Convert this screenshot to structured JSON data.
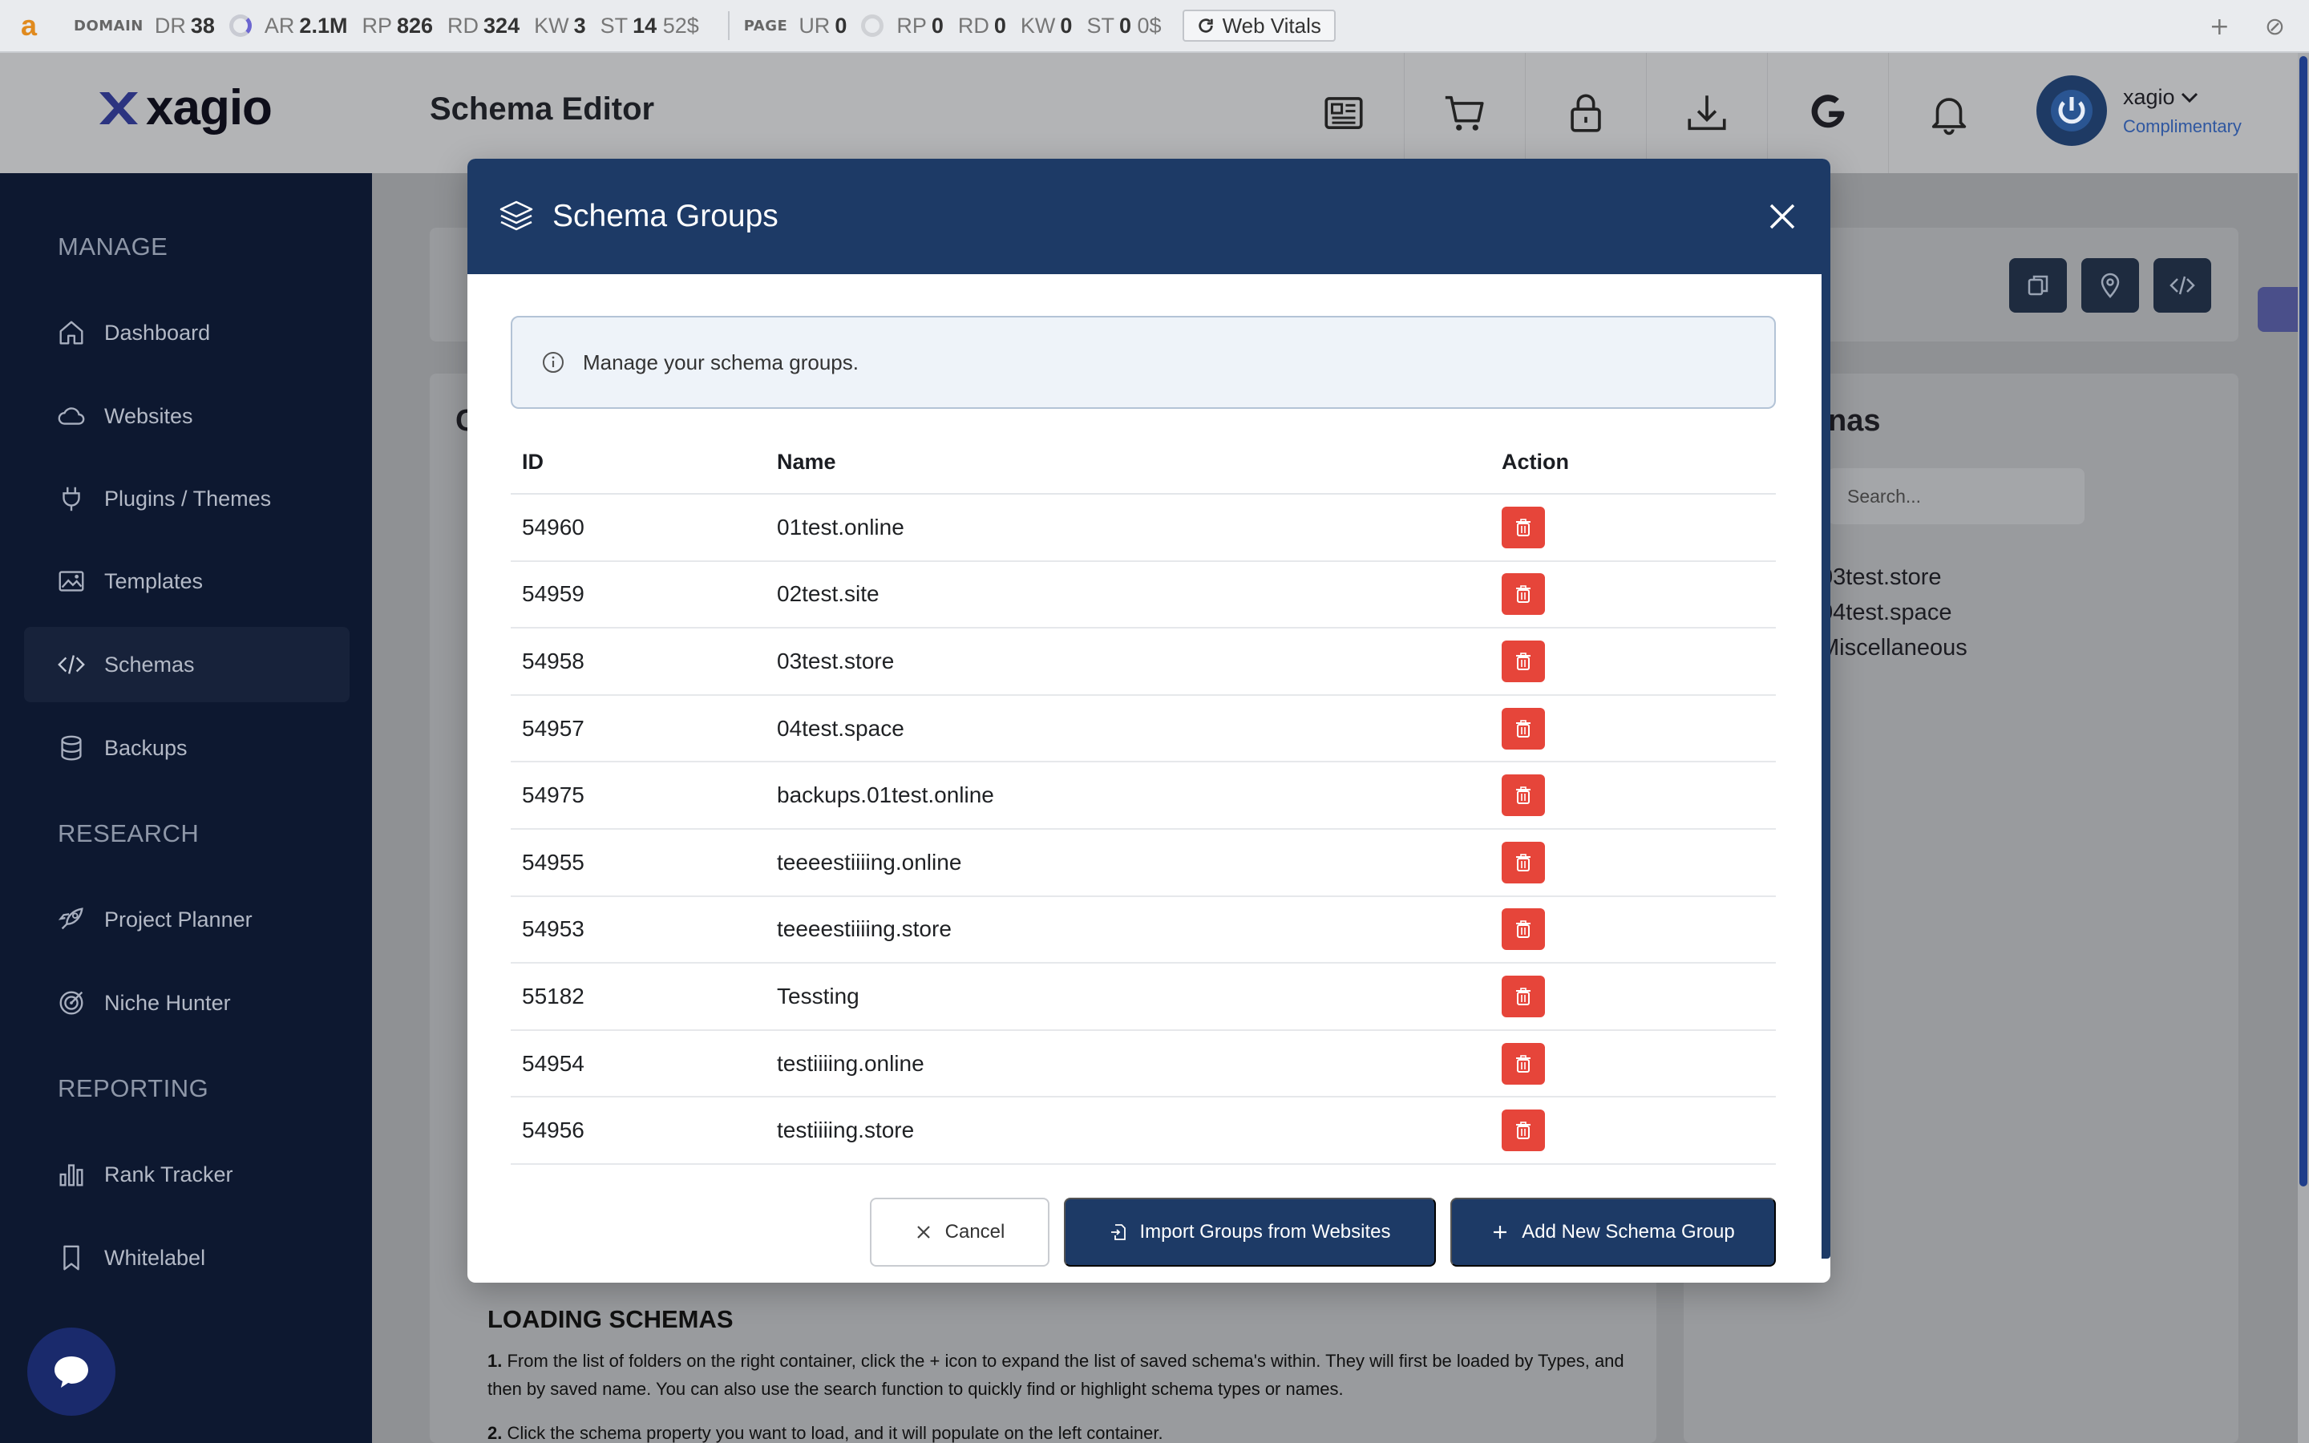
{
  "seo_bar": {
    "logo": "a",
    "domain_label": "DOMAIN",
    "domain": [
      {
        "k": "DR",
        "v": "38"
      },
      {
        "k": "AR",
        "v": "2.1M"
      },
      {
        "k": "RP",
        "v": "826"
      },
      {
        "k": "RD",
        "v": "324"
      },
      {
        "k": "KW",
        "v": "3"
      },
      {
        "k": "ST",
        "v": "14"
      }
    ],
    "domain_cost": "52$",
    "page_label": "PAGE",
    "page": [
      {
        "k": "UR",
        "v": "0"
      },
      {
        "k": "RP",
        "v": "0"
      },
      {
        "k": "RD",
        "v": "0"
      },
      {
        "k": "KW",
        "v": "0"
      },
      {
        "k": "ST",
        "v": "0"
      }
    ],
    "page_cost": "0$",
    "web_vitals": "Web Vitals",
    "plus": "+",
    "block": "⊘"
  },
  "header": {
    "logo_text": "xagio",
    "title": "Schema Editor",
    "icons": [
      "news-icon",
      "cart-icon",
      "lock-icon",
      "download-icon",
      "google-icon",
      "bell-icon"
    ],
    "user_name": "xagio",
    "user_plan": "Complimentary"
  },
  "sidebar": {
    "sections": [
      {
        "title": "MANAGE",
        "items": [
          "Dashboard",
          "Websites",
          "Plugins / Themes",
          "Templates",
          "Schemas",
          "Backups"
        ]
      },
      {
        "title": "RESEARCH",
        "items": [
          "Project Planner",
          "Niche Hunter"
        ]
      },
      {
        "title": "REPORTING",
        "items": [
          "Rank Tracker",
          "Whitelabel"
        ]
      }
    ],
    "active": "Schemas"
  },
  "background": {
    "left_card_letter": "C",
    "right_card_title": "nas",
    "search_placeholder": "Search...",
    "right_items": [
      "03test.store",
      "04test.space",
      "Miscellaneous"
    ],
    "loading_title": "LOADING SCHEMAS",
    "loading_step1_num": "1.",
    "loading_step1": "From the list of folders on the right container, click the + icon to expand the list of saved schema's within. They will first be loaded by Types, and then by saved name. You can also use the search function to quickly find or highlight schema types or names.",
    "loading_step2_num": "2.",
    "loading_step2": "Click the schema property you want to load, and it will populate on the left container."
  },
  "modal": {
    "title": "Schema Groups",
    "info": "Manage your schema groups.",
    "columns": [
      "ID",
      "Name",
      "Action"
    ],
    "rows": [
      {
        "id": "54960",
        "name": "01test.online"
      },
      {
        "id": "54959",
        "name": "02test.site"
      },
      {
        "id": "54958",
        "name": "03test.store"
      },
      {
        "id": "54957",
        "name": "04test.space"
      },
      {
        "id": "54975",
        "name": "backups.01test.online"
      },
      {
        "id": "54955",
        "name": "teeeestiiiing.online"
      },
      {
        "id": "54953",
        "name": "teeeestiiiing.store"
      },
      {
        "id": "55182",
        "name": "Tessting"
      },
      {
        "id": "54954",
        "name": "testiiiing.online"
      },
      {
        "id": "54956",
        "name": "testiiiing.store"
      }
    ],
    "buttons": {
      "cancel": "Cancel",
      "import": "Import Groups from Websites",
      "add": "Add New Schema Group"
    }
  },
  "colors": {
    "navy": "#1d3a66",
    "sidebar": "#0d1830",
    "delete": "#e6453a"
  }
}
